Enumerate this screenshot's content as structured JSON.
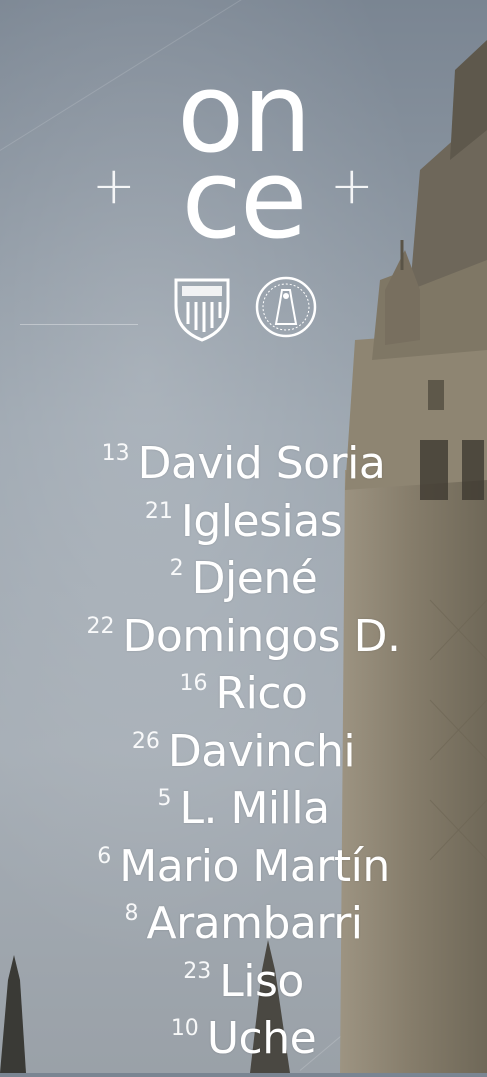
{
  "title": {
    "line1": "on",
    "line2": "ce",
    "plus_symbol": "+"
  },
  "crests": [
    {
      "icon": "sevilla-fc-crest-icon"
    },
    {
      "icon": "city-seal-crest-icon"
    }
  ],
  "lineup": [
    {
      "number": "13",
      "name": "David Soria"
    },
    {
      "number": "21",
      "name": "Iglesias"
    },
    {
      "number": "2",
      "name": "Djené"
    },
    {
      "number": "22",
      "name": "Domingos D."
    },
    {
      "number": "16",
      "name": "Rico"
    },
    {
      "number": "26",
      "name": "Davinchi"
    },
    {
      "number": "5",
      "name": "L. Milla"
    },
    {
      "number": "6",
      "name": "Mario Martín"
    },
    {
      "number": "8",
      "name": "Arambarri"
    },
    {
      "number": "23",
      "name": "Liso"
    },
    {
      "number": "10",
      "name": "Uche"
    }
  ],
  "colors": {
    "text": "#ffffff",
    "sky": "#9aa4ae",
    "tower": "#8a8270"
  }
}
